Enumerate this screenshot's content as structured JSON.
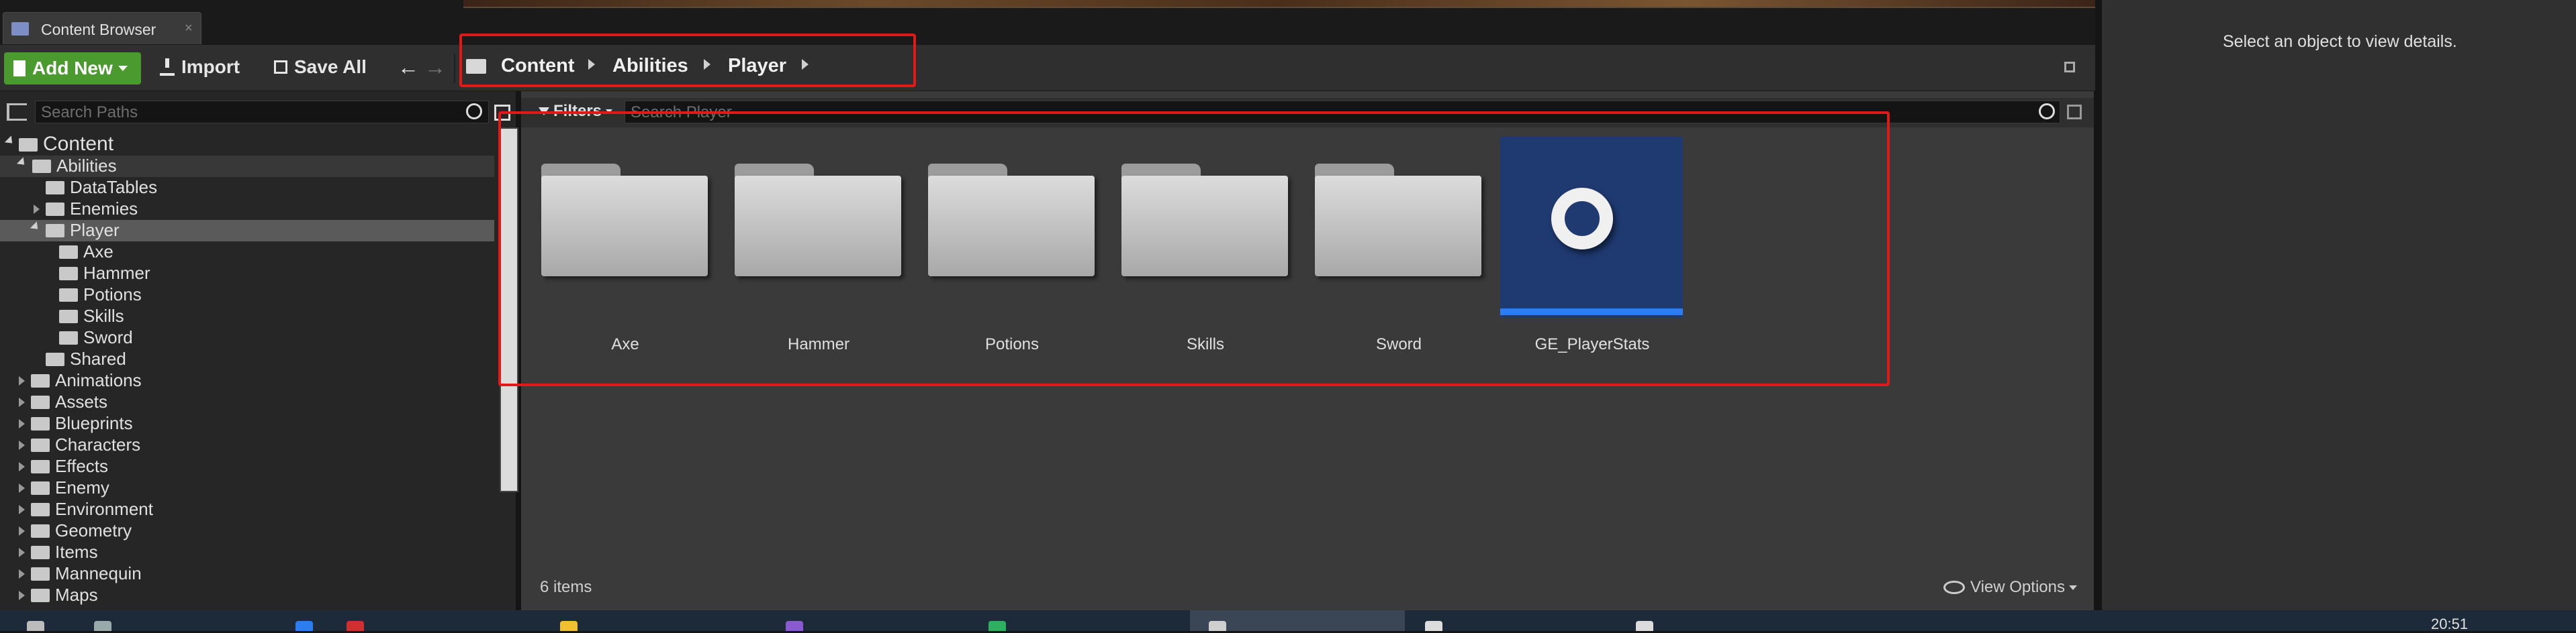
{
  "window": {
    "tab_label": "Content Browser"
  },
  "toolbar": {
    "add_new": "Add New",
    "import": "Import",
    "save_all": "Save All",
    "breadcrumbs": [
      "Content",
      "Abilities",
      "Player"
    ]
  },
  "left": {
    "search_placeholder": "Search Paths",
    "tree": [
      {
        "label": "Content"
      },
      {
        "label": "Abilities"
      },
      {
        "label": "DataTables"
      },
      {
        "label": "Enemies"
      },
      {
        "label": "Player"
      },
      {
        "label": "Axe"
      },
      {
        "label": "Hammer"
      },
      {
        "label": "Potions"
      },
      {
        "label": "Skills"
      },
      {
        "label": "Sword"
      },
      {
        "label": "Shared"
      },
      {
        "label": "Animations"
      },
      {
        "label": "Assets"
      },
      {
        "label": "Blueprints"
      },
      {
        "label": "Characters"
      },
      {
        "label": "Effects"
      },
      {
        "label": "Enemy"
      },
      {
        "label": "Environment"
      },
      {
        "label": "Geometry"
      },
      {
        "label": "Items"
      },
      {
        "label": "Mannequin"
      },
      {
        "label": "Maps"
      }
    ]
  },
  "main": {
    "filters_label": "Filters",
    "search_placeholder": "Search Player",
    "items": [
      {
        "label": "Axe"
      },
      {
        "label": "Hammer"
      },
      {
        "label": "Potions"
      },
      {
        "label": "Skills"
      },
      {
        "label": "Sword"
      },
      {
        "label": "GE_PlayerStats"
      }
    ],
    "status": "6 items",
    "view_options": "View Options"
  },
  "details": {
    "hint": "Select an object to view details."
  },
  "taskbar": {
    "time": "20:51"
  },
  "colors": {
    "accent_green": "#4a9a2f",
    "highlight_red": "#e01919",
    "asset_blue": "#1f3a70",
    "asset_bar": "#2d7cf0"
  },
  "icons": [
    "folder-icon",
    "save-icon",
    "import-icon",
    "back-arrow-icon",
    "forward-arrow-icon",
    "lock-icon",
    "search-icon",
    "eye-icon"
  ]
}
